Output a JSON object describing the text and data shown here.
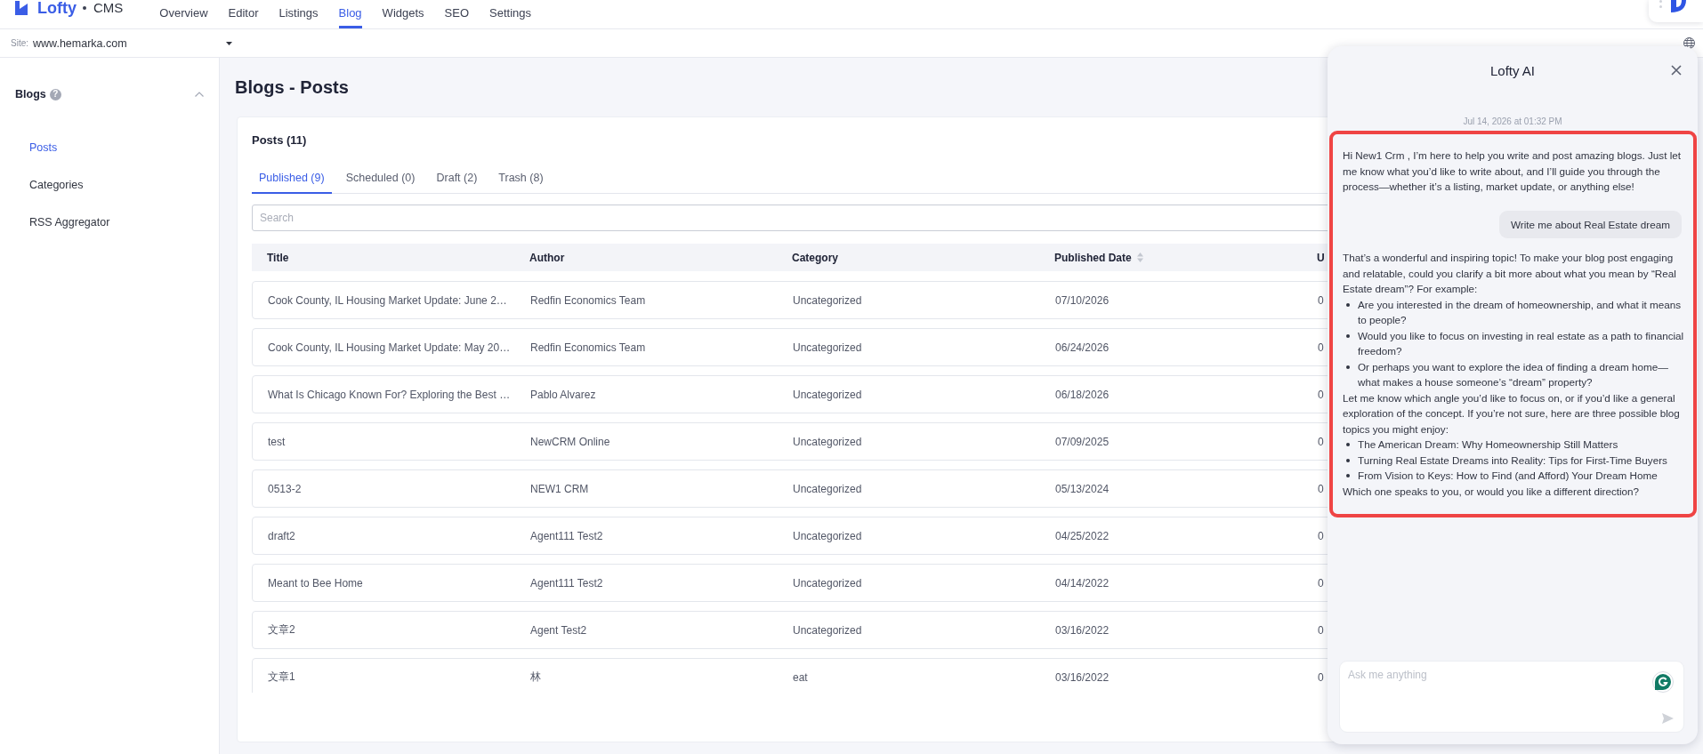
{
  "top_nav": {
    "brand": "Lofty",
    "product": "CMS",
    "items": [
      {
        "label": "Overview",
        "selected": false
      },
      {
        "label": "Editor",
        "selected": false
      },
      {
        "label": "Listings",
        "selected": false
      },
      {
        "label": "Blog",
        "selected": true
      },
      {
        "label": "Widgets",
        "selected": false
      },
      {
        "label": "SEO",
        "selected": false
      },
      {
        "label": "Settings",
        "selected": false
      }
    ]
  },
  "site_bar": {
    "label": "Site:",
    "value": "www.hemarka.com"
  },
  "sidebar": {
    "title": "Blogs",
    "help": "?",
    "expanded": true,
    "items": [
      {
        "label": "Posts",
        "selected": true
      },
      {
        "label": "Categories",
        "selected": false
      },
      {
        "label": "RSS Aggregator",
        "selected": false
      }
    ]
  },
  "page_title": "Blogs - Posts",
  "posts": {
    "title": "Posts (11)",
    "tabs": [
      {
        "label": "Published (9)",
        "selected": true
      },
      {
        "label": "Scheduled (0)",
        "selected": false
      },
      {
        "label": "Draft (2)",
        "selected": false
      },
      {
        "label": "Trash (8)",
        "selected": false
      }
    ],
    "search": {
      "placeholder": "Search"
    },
    "table": {
      "columns": [
        {
          "label": "Title",
          "sortable": false
        },
        {
          "label": "Author",
          "sortable": false
        },
        {
          "label": "Category",
          "sortable": false
        },
        {
          "label": "Published Date",
          "sortable": true
        },
        {
          "label": "U",
          "sortable": false
        }
      ],
      "rows": [
        [
          "Cook County, IL Housing Market Update: June 2…",
          "Redfin Economics Team",
          "Uncategorized",
          "07/10/2026",
          "0"
        ],
        [
          "Cook County, IL Housing Market Update: May 20…",
          "Redfin Economics Team",
          "Uncategorized",
          "06/24/2026",
          "0"
        ],
        [
          "What Is Chicago Known For? Exploring the Best …",
          "Pablo Alvarez",
          "Uncategorized",
          "06/18/2026",
          "0"
        ],
        [
          "test",
          "NewCRM Online",
          "Uncategorized",
          "07/09/2025",
          "0"
        ],
        [
          "0513-2",
          "NEW1 CRM",
          "Uncategorized",
          "05/13/2024",
          "0"
        ],
        [
          "draft2",
          "Agent111 Test2",
          "Uncategorized",
          "04/25/2022",
          "0"
        ],
        [
          "Meant to Bee Home",
          "Agent111 Test2",
          "Uncategorized",
          "04/14/2022",
          "0"
        ],
        [
          "文章2",
          "Agent Test2",
          "Uncategorized",
          "03/16/2022",
          "0"
        ],
        [
          "文章1",
          "林",
          "eat",
          "03/16/2022",
          "0"
        ]
      ]
    }
  },
  "chat": {
    "title": "Lofty AI",
    "timestamp": "Jul 14, 2026 at 01:32 PM",
    "highlighted": true,
    "messages": [
      {
        "kind": "reply",
        "blocks": [
          {
            "kind": "paragraph",
            "text": "Hi New1 Crm , I’m here to help you write and post amazing blogs. Just let me know what you’d like to write about, and I’ll guide you through the process—whether it’s a listing, market update, or anything else!"
          }
        ]
      },
      {
        "kind": "prompt",
        "text": "Write me about Real Estate dream"
      },
      {
        "kind": "reply",
        "blocks": [
          {
            "kind": "paragraph",
            "text": "That’s a wonderful and inspiring topic! To make your blog post engaging and relatable, could you clarify a bit more about what you mean by “Real Estate dream”? For example:"
          },
          {
            "kind": "list",
            "items": [
              "Are you interested in the dream of homeownership, and what it means to people?",
              "Would you like to focus on investing in real estate as a path to financial freedom?",
              "Or perhaps you want to explore the idea of finding a dream home—what makes a house someone’s “dream” property?"
            ]
          },
          {
            "kind": "paragraph",
            "text": "Let me know which angle you’d like to focus on, or if you’d like a general exploration of the concept. If you’re not sure, here are three possible blog topics you might enjoy:"
          },
          {
            "kind": "list",
            "items": [
              "The American Dream: Why Homeownership Still Matters",
              "Turning Real Estate Dreams into Reality: Tips for First-Time Buyers",
              "From Vision to Keys: How to Find (and Afford) Your Dream Home"
            ]
          },
          {
            "kind": "paragraph",
            "text": "Which one speaks to you, or would you like a different direction?"
          }
        ]
      }
    ],
    "input": {
      "placeholder": "Ask me anything"
    }
  }
}
